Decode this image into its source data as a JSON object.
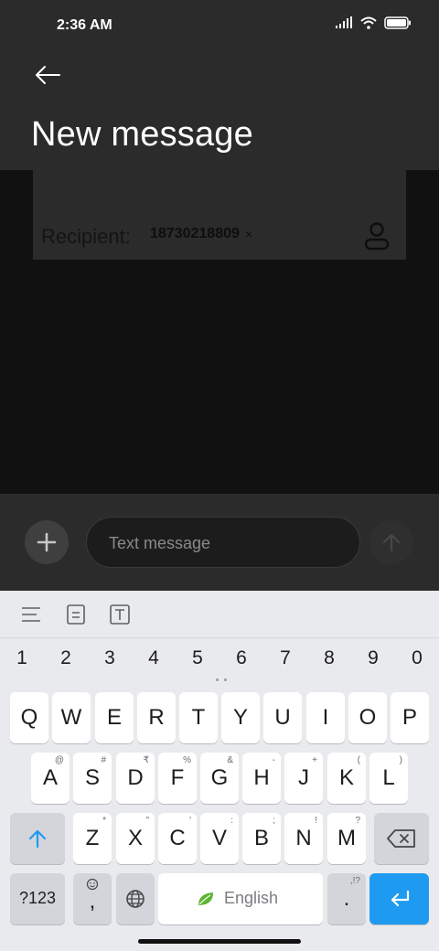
{
  "status_bar": {
    "time": "2:36 AM"
  },
  "header": {
    "title": "New message"
  },
  "recipient": {
    "label": "Recipient:",
    "number": "18730218809",
    "remove_symbol": "×"
  },
  "compose": {
    "placeholder": "Text message"
  },
  "keyboard": {
    "numbers": [
      "1",
      "2",
      "3",
      "4",
      "5",
      "6",
      "7",
      "8",
      "9",
      "0"
    ],
    "row1": [
      "Q",
      "W",
      "E",
      "R",
      "T",
      "Y",
      "U",
      "I",
      "O",
      "P"
    ],
    "row2": [
      {
        "key": "A",
        "hint": "@"
      },
      {
        "key": "S",
        "hint": "#"
      },
      {
        "key": "D",
        "hint": "₹"
      },
      {
        "key": "F",
        "hint": "%"
      },
      {
        "key": "G",
        "hint": "&"
      },
      {
        "key": "H",
        "hint": "-"
      },
      {
        "key": "J",
        "hint": "+"
      },
      {
        "key": "K",
        "hint": "("
      },
      {
        "key": "L",
        "hint": ")"
      }
    ],
    "row3": [
      {
        "key": "Z",
        "hint": "*"
      },
      {
        "key": "X",
        "hint": "\""
      },
      {
        "key": "C",
        "hint": "'"
      },
      {
        "key": "V",
        "hint": ":"
      },
      {
        "key": "B",
        "hint": ";"
      },
      {
        "key": "N",
        "hint": "!"
      },
      {
        "key": "M",
        "hint": "?"
      }
    ],
    "symbols_label": "?123",
    "comma_label": ",",
    "space_label": "English",
    "period_label": ".",
    "period_hint": ",!?"
  },
  "colors": {
    "accent": "#1e9bf0",
    "leaf": "#5cb531"
  }
}
